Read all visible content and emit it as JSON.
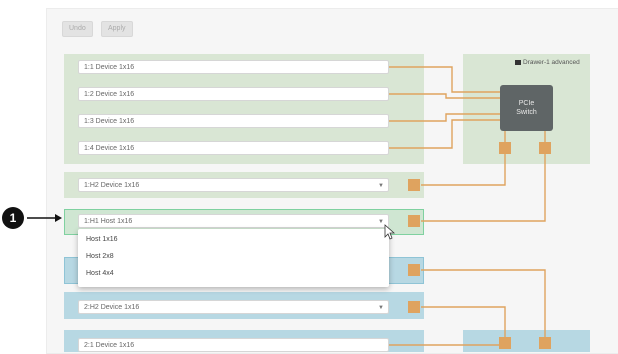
{
  "toolbar": {
    "undo_label": "Undo",
    "apply_label": "Apply"
  },
  "drawer": {
    "icon": "drawer-icon",
    "label": "Drawer-1 advanced"
  },
  "pcie_switch": {
    "line1": "PCIe",
    "line2": "Switch"
  },
  "slots": {
    "s11": "1:1 Device 1x16",
    "s12": "1:2 Device 1x16",
    "s13": "1:3 Device 1x16",
    "s14": "1:4 Device 1x16",
    "h2": "1:H2 Device 1x16",
    "h1": "1:H1 Host 1x16",
    "s2h2": "2:H2 Device 1x16",
    "s21": "2:1 Device 1x16"
  },
  "dropdown": {
    "options": [
      "Host 1x16",
      "Host 2x8",
      "Host 4x4"
    ]
  },
  "callout": {
    "number": "1"
  },
  "colors": {
    "green_region": "#d9e6d4",
    "blue_region": "#b7d8e3",
    "port": "#dfa35f",
    "switch": "#5f6566",
    "selected_border": "#7fd1a0"
  }
}
